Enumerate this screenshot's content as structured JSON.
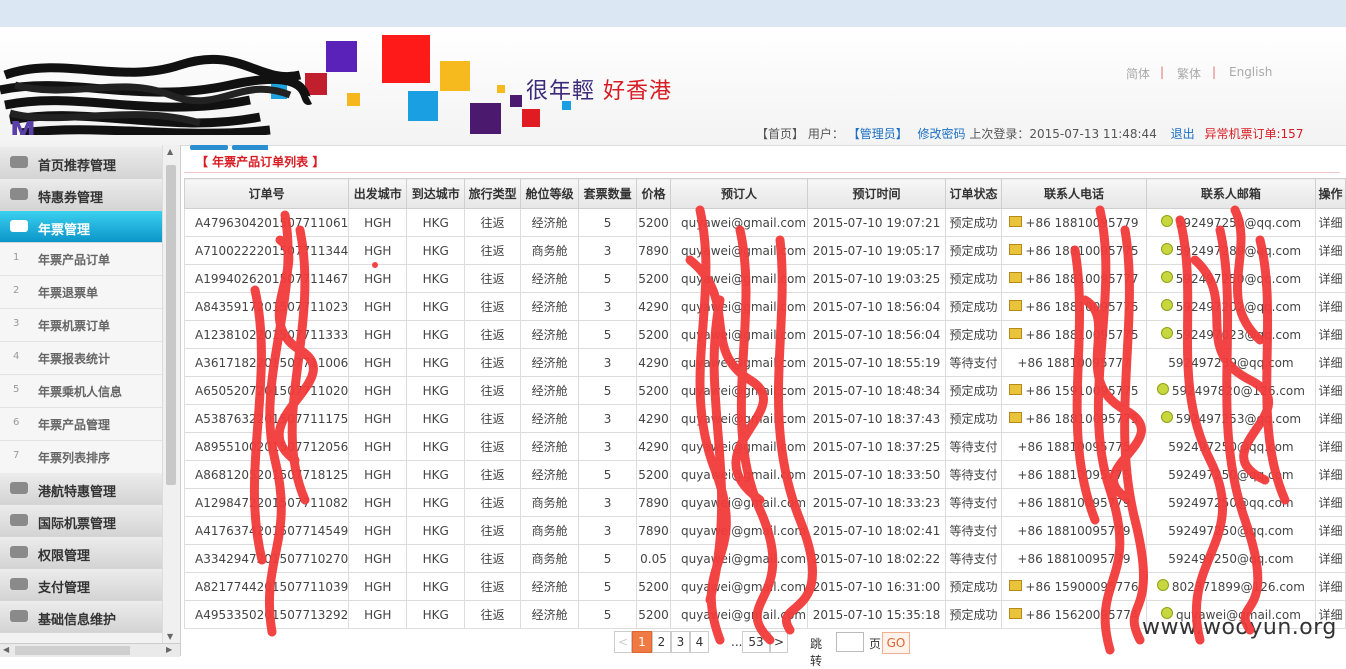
{
  "header": {
    "slogan_part1": "很年輕",
    "slogan_part2": "好香港",
    "lang": [
      "简体",
      "繁体",
      "English"
    ],
    "lang_sep": "|",
    "home": "【首页】",
    "user_label": "用户：",
    "user_name": "【管理员】",
    "change_pwd": "修改密码",
    "last_login": "上次登录：2015-07-13 11:48:44",
    "logout": "退出",
    "alert": "异常机票订单:157"
  },
  "sidebar": {
    "items": [
      {
        "label": "首页推荐管理",
        "active": false
      },
      {
        "label": "特惠券管理",
        "active": false
      },
      {
        "label": "年票管理",
        "active": true
      },
      {
        "label": "港航特惠管理",
        "active": false
      },
      {
        "label": "国际机票管理",
        "active": false
      },
      {
        "label": "权限管理",
        "active": false
      },
      {
        "label": "支付管理",
        "active": false
      },
      {
        "label": "基础信息维护",
        "active": false
      }
    ],
    "subitems": [
      {
        "num": "1",
        "label": "年票产品订单"
      },
      {
        "num": "2",
        "label": "年票退票单"
      },
      {
        "num": "3",
        "label": "年票机票订单"
      },
      {
        "num": "4",
        "label": "年票报表统计"
      },
      {
        "num": "5",
        "label": "年票乘机人信息"
      },
      {
        "num": "6",
        "label": "年票产品管理"
      },
      {
        "num": "7",
        "label": "年票列表排序"
      }
    ]
  },
  "main": {
    "title": "【 年票产品订单列表 】",
    "columns": [
      "订单号",
      "出发城市",
      "到达城市",
      "旅行类型",
      "舱位等级",
      "套票数量",
      "价格",
      "预订人",
      "预订时间",
      "订单状态",
      "联系人电话",
      "联系人邮箱",
      "操作"
    ],
    "rows": [
      [
        "A4796304201507711061",
        "HGH",
        "HKG",
        "往返",
        "经济舱",
        "5",
        "5200",
        "quyawei@gmail.com",
        "2015-07-10 19:07:21",
        "预定成功",
        "+86 18810095779",
        "592497250@qq.com",
        "详细"
      ],
      [
        "A7100222201507711344",
        "HGH",
        "HKG",
        "往返",
        "商务舱",
        "3",
        "7890",
        "quyawei@gmail.com",
        "2015-07-10 19:05:17",
        "预定成功",
        "+86 18810095775",
        "592497289@qq.com",
        "详细"
      ],
      [
        "A1994026201507711467",
        "HGH",
        "HKG",
        "往返",
        "经济舱",
        "5",
        "5200",
        "quyawei@gmail.com",
        "2015-07-10 19:03:25",
        "预定成功",
        "+86 18810095777",
        "592497250@qq.com",
        "详细"
      ],
      [
        "A8435917201507711023",
        "HGH",
        "HKG",
        "往返",
        "经济舱",
        "3",
        "4290",
        "quyawei@gmail.com",
        "2015-07-10 18:56:04",
        "预定成功",
        "+86 18810095775",
        "592497202@qq.com",
        "详细"
      ],
      [
        "A1238102201507711333",
        "HGH",
        "HKG",
        "往返",
        "经济舱",
        "5",
        "5200",
        "quyawei@gmail.com",
        "2015-07-10 18:56:04",
        "预定成功",
        "+86 18810095775",
        "592497023@qq.com",
        "详细"
      ],
      [
        "A3617182201507711006",
        "HGH",
        "HKG",
        "往返",
        "经济舱",
        "3",
        "4290",
        "quyawei@gmail.com",
        "2015-07-10 18:55:19",
        "等待支付",
        "+86 18810095777",
        "592497239@qq.com",
        "详细"
      ],
      [
        "A6505207201507711020",
        "HGH",
        "HKG",
        "往返",
        "经济舱",
        "5",
        "5200",
        "quyawei@gmail.com",
        "2015-07-10 18:48:34",
        "预定成功",
        "+86 15910095775",
        "592497820@126.com",
        "详细"
      ],
      [
        "A5387632201507711175",
        "HGH",
        "HKG",
        "往返",
        "经济舱",
        "3",
        "4290",
        "quyawei@gmail.com",
        "2015-07-10 18:37:43",
        "预定成功",
        "+86 18810095775",
        "592497253@qq.com",
        "详细"
      ],
      [
        "A8955100201507712056",
        "HGH",
        "HKG",
        "往返",
        "经济舱",
        "3",
        "4290",
        "quyawei@gmail.com",
        "2015-07-10 18:37:25",
        "等待支付",
        "+86 18810095775",
        "592497250@qq.com",
        "详细"
      ],
      [
        "A8681205201507718125",
        "HGH",
        "HKG",
        "往返",
        "经济舱",
        "5",
        "5200",
        "quyawei@gmail.com",
        "2015-07-10 18:33:50",
        "等待支付",
        "+86 18810095775",
        "592497250@qq.com",
        "详细"
      ],
      [
        "A1298472201507711082",
        "HGH",
        "HKG",
        "往返",
        "商务舱",
        "3",
        "7890",
        "quyawei@gmail.com",
        "2015-07-10 18:33:23",
        "等待支付",
        "+86 18810095779",
        "592497250@qq.com",
        "详细"
      ],
      [
        "A4176374201507714549",
        "HGH",
        "HKG",
        "往返",
        "商务舱",
        "3",
        "7890",
        "quyawei@gmail.com",
        "2015-07-10 18:02:41",
        "等待支付",
        "+86 18810095779",
        "592497250@qq.com",
        "详细"
      ],
      [
        "A3342947201507710270",
        "HGH",
        "HKG",
        "往返",
        "商务舱",
        "5",
        "0.05",
        "quyawei@gmail.com",
        "2015-07-10 18:02:22",
        "等待支付",
        "+86 18810095779",
        "592497250@qq.com",
        "详细"
      ],
      [
        "A8217744201507711039",
        "HGH",
        "HKG",
        "往返",
        "经济舱",
        "5",
        "5200",
        "quyawei@gmail.com",
        "2015-07-10 16:31:00",
        "预定成功",
        "+86 15900095776",
        "802371899@126.com",
        "详细"
      ],
      [
        "A4953350201507713292",
        "HGH",
        "HKG",
        "往返",
        "经济舱",
        "5",
        "5200",
        "quyawei@gmail.com",
        "2015-07-10 15:35:18",
        "预定成功",
        "+86 15620095774",
        "quyawei@gmail.com",
        "详细"
      ]
    ],
    "icons": {
      "phone": "phone-card-icon",
      "mail": "mail-icon"
    }
  },
  "pager": {
    "prev": "<",
    "pages": [
      "1",
      "2",
      "3",
      "4"
    ],
    "ellipsis": "...",
    "last": "53",
    "next": ">",
    "jump_label": "跳转",
    "jump_value": "",
    "page_unit": "页",
    "go": "GO"
  },
  "watermark": "www.wooyun.org",
  "colors": {
    "accent": "#0b95c9",
    "alert_red": "#d91c24",
    "link_blue": "#1a6fc4",
    "current_page": "#f07a43"
  }
}
